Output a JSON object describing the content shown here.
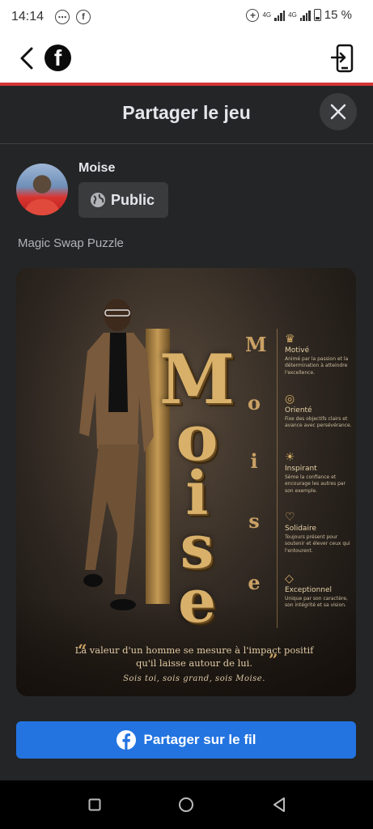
{
  "status_bar": {
    "time": "14:14",
    "network_1": "4G",
    "network_2": "4G",
    "battery": "15 %"
  },
  "header": {
    "back_icon": "chevron-left-icon",
    "logo_letter": "f",
    "exit_icon": "sign-in-icon"
  },
  "sheet": {
    "title": "Partager le jeu",
    "close_icon": "close-icon",
    "user_name": "Moise",
    "privacy_label": "Public",
    "privacy_icon": "globe-icon",
    "game_name": "Magic Swap Puzzle"
  },
  "poster": {
    "big_letters": [
      "M",
      "o",
      "i",
      "s",
      "e"
    ],
    "side_letters": [
      "M",
      "o",
      "i",
      "s",
      "e"
    ],
    "traits": [
      {
        "icon": "crown-icon",
        "glyph": "♛",
        "title": "Motivé",
        "desc": "Animé par la passion et la détermination à atteindre l'excellence."
      },
      {
        "icon": "target-icon",
        "glyph": "◎",
        "title": "Orienté",
        "desc": "Fixe des objectifs clairs et avance avec persévérance."
      },
      {
        "icon": "lightbulb-icon",
        "glyph": "☀",
        "title": "Inspirant",
        "desc": "Sème la confiance et encourage les autres par son exemple."
      },
      {
        "icon": "heart-hands-icon",
        "glyph": "♡",
        "title": "Solidaire",
        "desc": "Toujours présent pour soutenir et élever ceux qui l'entourent."
      },
      {
        "icon": "diamond-icon",
        "glyph": "◇",
        "title": "Exceptionnel",
        "desc": "Unique par son caractère, son intégrité et sa vision."
      }
    ],
    "quote": "La valeur d'un homme se mesure à l'impact positif qu'il laisse autour de lui.",
    "signature": "Sois toi, sois grand, sois Moise."
  },
  "share_button": {
    "label": "Partager sur le fil",
    "icon": "facebook-icon"
  },
  "nav": {
    "recents_icon": "square-icon",
    "home_icon": "circle-icon",
    "back_icon": "triangle-back-icon"
  },
  "colors": {
    "background": "#242526",
    "accent": "#2374e1",
    "header_line": "#d33436",
    "poster_gold": "#d8b06a"
  }
}
